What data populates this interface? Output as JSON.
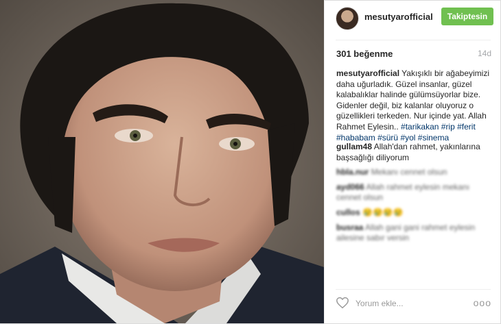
{
  "post": {
    "username": "mesutyarofficial",
    "follow_label": "Takiptesin",
    "likes": "301 beğenme",
    "time": "14d",
    "caption_user": "mesutyarofficial",
    "caption_text": "Yakışıklı bir ağabeyimizi daha uğurladık. Güzel insanlar, güzel kalabalıklar halinde gülümsüyorlar bize. Gidenler değil, biz kalanlar oluyoruz o güzellikleri terkeden. Nur içinde yat. Allah Rahmet Eylesin..",
    "hashtags": [
      "#tarikakan",
      "#rip",
      "#ferit",
      "#hababam",
      "#sürü",
      "#yol",
      "#sinema"
    ],
    "add_comment_placeholder": "Yorum ekle...",
    "more_label": "ooo"
  },
  "comments": [
    {
      "user": "gullam48",
      "text": "Allah'dan rahmet, yakınlarına başsağlığı diliyorum"
    },
    {
      "user": "hbla.nur",
      "text": "Mekanı cennet olsun"
    },
    {
      "user": "ayd066",
      "text": "Allah rahmet eylesin mekanı cennet olsun"
    },
    {
      "user": "cullos",
      "text": "😢😢😢😢"
    },
    {
      "user": "busraa",
      "text": "Allah gani gani rahmet eylesin ailesine sabır versin"
    }
  ],
  "colors": {
    "follow_bg": "#70c050",
    "hashtag": "#003569",
    "time": "#a5a7aa"
  }
}
